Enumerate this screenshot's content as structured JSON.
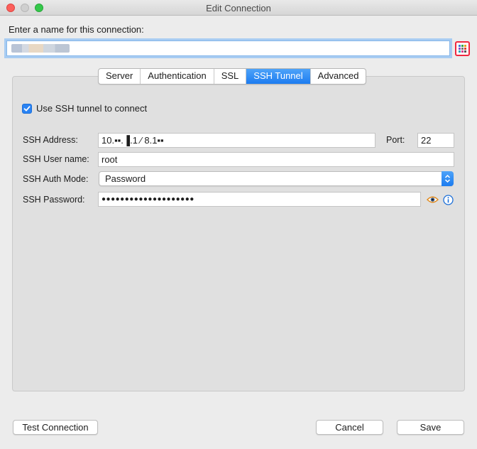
{
  "window": {
    "title": "Edit Connection"
  },
  "connection": {
    "name_label": "Enter a name for this connection:",
    "name_value": "██████"
  },
  "tabs": [
    {
      "label": "Server",
      "active": false
    },
    {
      "label": "Authentication",
      "active": false
    },
    {
      "label": "SSL",
      "active": false
    },
    {
      "label": "SSH Tunnel",
      "active": true
    },
    {
      "label": "Advanced",
      "active": false
    }
  ],
  "ssh": {
    "use_tunnel_label": "Use SSH tunnel to connect",
    "use_tunnel_checked": true,
    "address_label": "SSH Address:",
    "address_value": "10.▪▪.▐.1 ⁄ 8.1▪▪",
    "port_label": "Port:",
    "port_value": "22",
    "user_label": "SSH User name:",
    "user_value": "root",
    "auth_mode_label": "SSH Auth Mode:",
    "auth_mode_value": "Password",
    "password_label": "SSH Password:",
    "password_value": "●●●●●●●●●●●●●●●●●●●●"
  },
  "buttons": {
    "test": "Test Connection",
    "cancel": "Cancel",
    "save": "Save"
  },
  "colors": {
    "accent": "#1c7cf0",
    "color_picker_border": "#f0283f",
    "eye_icon": "#e0891c",
    "info_icon": "#1c6fd8"
  },
  "icons": {
    "color_picker": "color-picker-icon",
    "eye": "eye-icon",
    "info": "info-icon",
    "select_arrows": "updown-arrows-icon",
    "check": "checkmark-icon"
  }
}
